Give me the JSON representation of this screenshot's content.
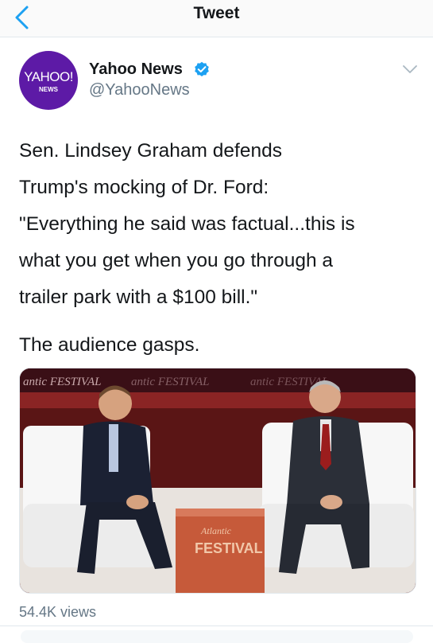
{
  "nav": {
    "title": "Tweet"
  },
  "author": {
    "avatar_wordmark": "YAHOO!",
    "avatar_sub": "NEWS",
    "name": "Yahoo News",
    "handle": "@YahooNews"
  },
  "tweet": {
    "lines": [
      "Sen. Lindsey Graham defends",
      "Trump's mocking of Dr. Ford:",
      "\"Everything he said was factual...this is",
      "what you get when you go through a",
      "trailer park with a $100 bill.\"",
      "The audience gasps."
    ]
  },
  "video": {
    "banner_text": "antic FESTIVAL",
    "table_script": "Atlantic",
    "table_caps": "FESTIVAL"
  },
  "stats": {
    "views": "54.4K views"
  },
  "colors": {
    "brand_purple": "#5d1aa6",
    "verified_blue": "#1da1f2",
    "link_blue": "#1da1f2",
    "secondary_text": "#657786"
  }
}
